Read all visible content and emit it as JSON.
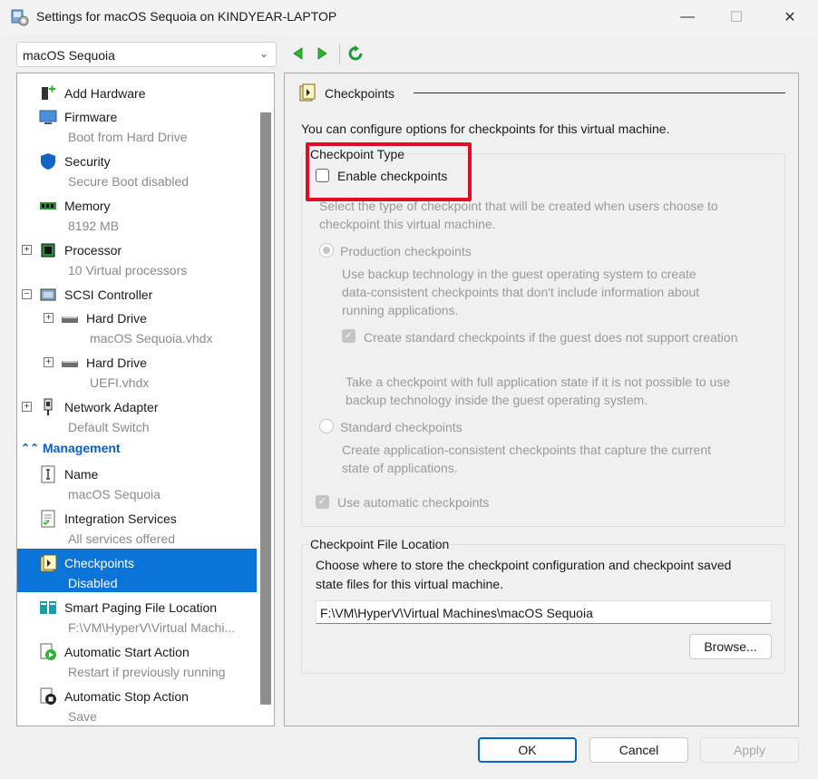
{
  "window": {
    "title": "Settings for macOS Sequoia on KINDYEAR-LAPTOP",
    "minimize": "—",
    "maximize": "☐",
    "close": "✕"
  },
  "vm_selector": {
    "value": "macOS Sequoia",
    "chevron": "⌄"
  },
  "sidebar": {
    "items": [
      {
        "label": "Add Hardware",
        "sub": "",
        "icon": "add-hardware-icon"
      },
      {
        "label": "Firmware",
        "sub": "Boot from Hard Drive",
        "icon": "firmware-icon"
      },
      {
        "label": "Security",
        "sub": "Secure Boot disabled",
        "icon": "shield-icon"
      },
      {
        "label": "Memory",
        "sub": "8192 MB",
        "icon": "memory-icon"
      },
      {
        "label": "Processor",
        "sub": "10 Virtual processors",
        "icon": "processor-icon",
        "expander": "+"
      },
      {
        "label": "SCSI Controller",
        "sub": "",
        "icon": "scsi-controller-icon",
        "expander": "−"
      },
      {
        "label": "Hard Drive",
        "sub": "macOS Sequoia.vhdx",
        "icon": "hard-drive-icon",
        "expander": "+"
      },
      {
        "label": "Hard Drive",
        "sub": "UEFI.vhdx",
        "icon": "hard-drive-icon",
        "expander": "+"
      },
      {
        "label": "Network Adapter",
        "sub": "Default Switch",
        "icon": "network-adapter-icon",
        "expander": "+"
      },
      {
        "label": "Name",
        "sub": "macOS Sequoia",
        "icon": "name-icon"
      },
      {
        "label": "Integration Services",
        "sub": "All services offered",
        "icon": "integration-services-icon"
      },
      {
        "label": "Checkpoints",
        "sub": "Disabled",
        "icon": "checkpoints-icon"
      },
      {
        "label": "Smart Paging File Location",
        "sub": "F:\\VM\\HyperV\\Virtual Machi...",
        "icon": "smart-paging-icon"
      },
      {
        "label": "Automatic Start Action",
        "sub": "Restart if previously running",
        "icon": "automatic-start-icon"
      },
      {
        "label": "Automatic Stop Action",
        "sub": "Save",
        "icon": "automatic-stop-icon"
      }
    ],
    "management_header": "Management",
    "management_chevron": "⌃⌃"
  },
  "checkpoints": {
    "header": "Checkpoints",
    "intro": "You can configure options for checkpoints for this virtual machine.",
    "type_group_title": "Checkpoint Type",
    "enable_label": "Enable checkpoints",
    "select_desc_1": "Select the type of checkpoint that will be created when users choose to",
    "select_desc_2": "checkpoint this virtual machine.",
    "production_label": "Production checkpoints",
    "production_desc_1": "Use backup technology in the guest operating system to create",
    "production_desc_2": "data-consistent checkpoints that don't include information about",
    "production_desc_3": "running applications.",
    "create_standard_label": "Create standard checkpoints if the guest does not support creation",
    "fallback_desc_1": "Take a checkpoint with full application state if it is not possible to use",
    "fallback_desc_2": "backup technology inside the guest operating system.",
    "standard_label": "Standard checkpoints",
    "standard_desc_1": "Create application-consistent checkpoints that capture the current",
    "standard_desc_2": "state of applications.",
    "automatic_label": "Use automatic checkpoints",
    "location_group_title": "Checkpoint File Location",
    "location_desc_1": "Choose where to store the checkpoint configuration and checkpoint saved",
    "location_desc_2": "state files for this virtual machine.",
    "location_path": "F:\\VM\\HyperV\\Virtual Machines\\macOS Sequoia",
    "browse_label": "Browse..."
  },
  "footer": {
    "ok": "OK",
    "cancel": "Cancel",
    "apply": "Apply"
  },
  "colors": {
    "selection": "#0a74d9",
    "highlight_box": "#e00e22",
    "nav_arrow": "#2db52d",
    "link_header": "#0a5ec9"
  }
}
